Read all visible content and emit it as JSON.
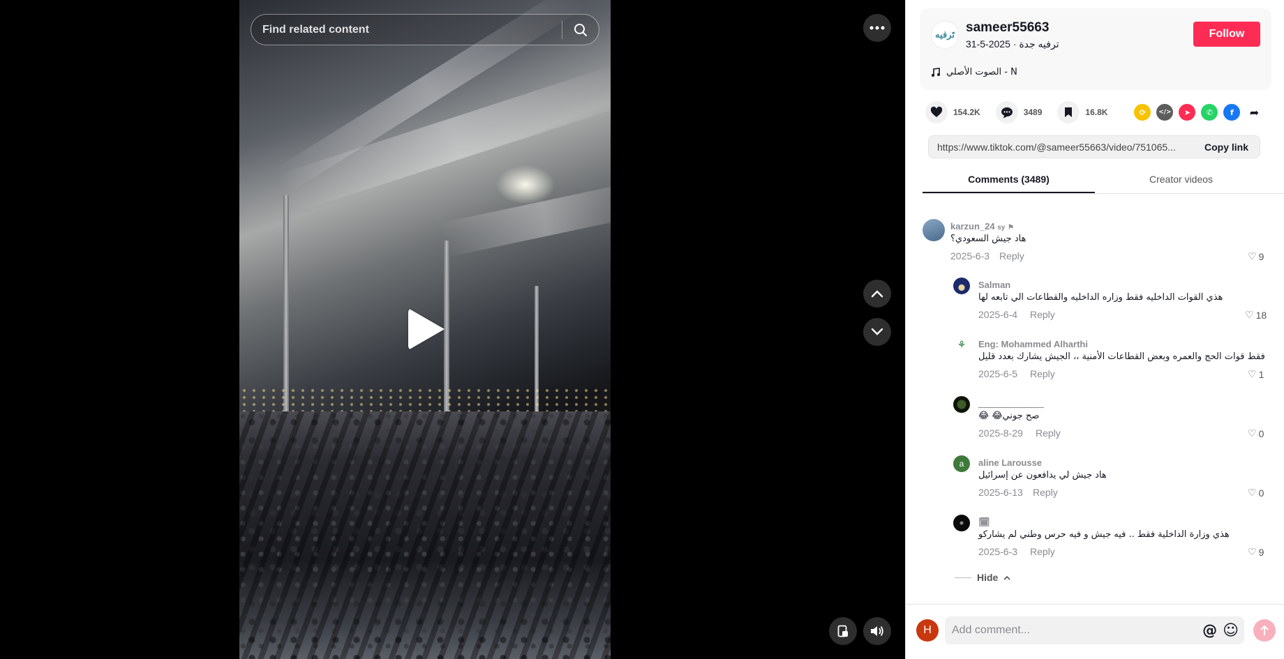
{
  "search": {
    "placeholder": "Find related content"
  },
  "video": {
    "state": "paused"
  },
  "post": {
    "username": "sameer55663",
    "nickname": "ترفيه جدة",
    "date": "2025-5-31",
    "meta_separator": " · ",
    "follow_label": "Follow",
    "music": "الصوت الأصلي - N",
    "avatar_text": "تَرفيه"
  },
  "stats": {
    "likes": "154.2K",
    "comments": "3489",
    "saves": "16.8K"
  },
  "link": {
    "url": "https://www.tiktok.com/@sameer55663/video/751065...",
    "copy_label": "Copy link"
  },
  "tabs": [
    {
      "label": "Comments (3489)",
      "active": true
    },
    {
      "label": "Creator videos",
      "active": false
    }
  ],
  "comments": [
    {
      "user": "karzun_24",
      "badge": "sy",
      "text": "هاد جيش السعودي؟",
      "date": "2025-6-3",
      "reply": "Reply",
      "likes": "9"
    },
    {
      "user": "Salman",
      "text": "هذي القوات الداخليه فقط وزاره الداخليه والقطاعات الي تابعه لها",
      "date": "2025-6-4",
      "reply": "Reply",
      "likes": "18"
    },
    {
      "user": "Eng: Mohammed Alharthi",
      "text": "فقط قوات الحج والعمره وبعض القطاعات الأمنية ،، الجيش يشارك بعدد قليل",
      "date": "2025-6-5",
      "reply": "Reply",
      "likes": "1"
    },
    {
      "user": "_____________",
      "text": "😂 😂صح جوني",
      "date": "2025-8-29",
      "reply": "Reply",
      "likes": "0"
    },
    {
      "user": "aline Larousse",
      "avatar_letter": "a",
      "text": "هاد جيش لي يدافعون عن إسرائيل",
      "date": "2025-6-13",
      "reply": "Reply",
      "likes": "0"
    },
    {
      "user": "🗓",
      "text": "هذي وزارة الداخلية فقط .. فيه جيش و فيه حرس وطني لم يشاركو",
      "date": "2025-6-3",
      "reply": "Reply",
      "likes": "9"
    }
  ],
  "hide_label": "Hide",
  "composer": {
    "placeholder": "Add comment...",
    "avatar_letter": "H"
  },
  "colors": {
    "accent": "#fe2c55",
    "text": "#161823",
    "muted": "#8a8b91"
  }
}
